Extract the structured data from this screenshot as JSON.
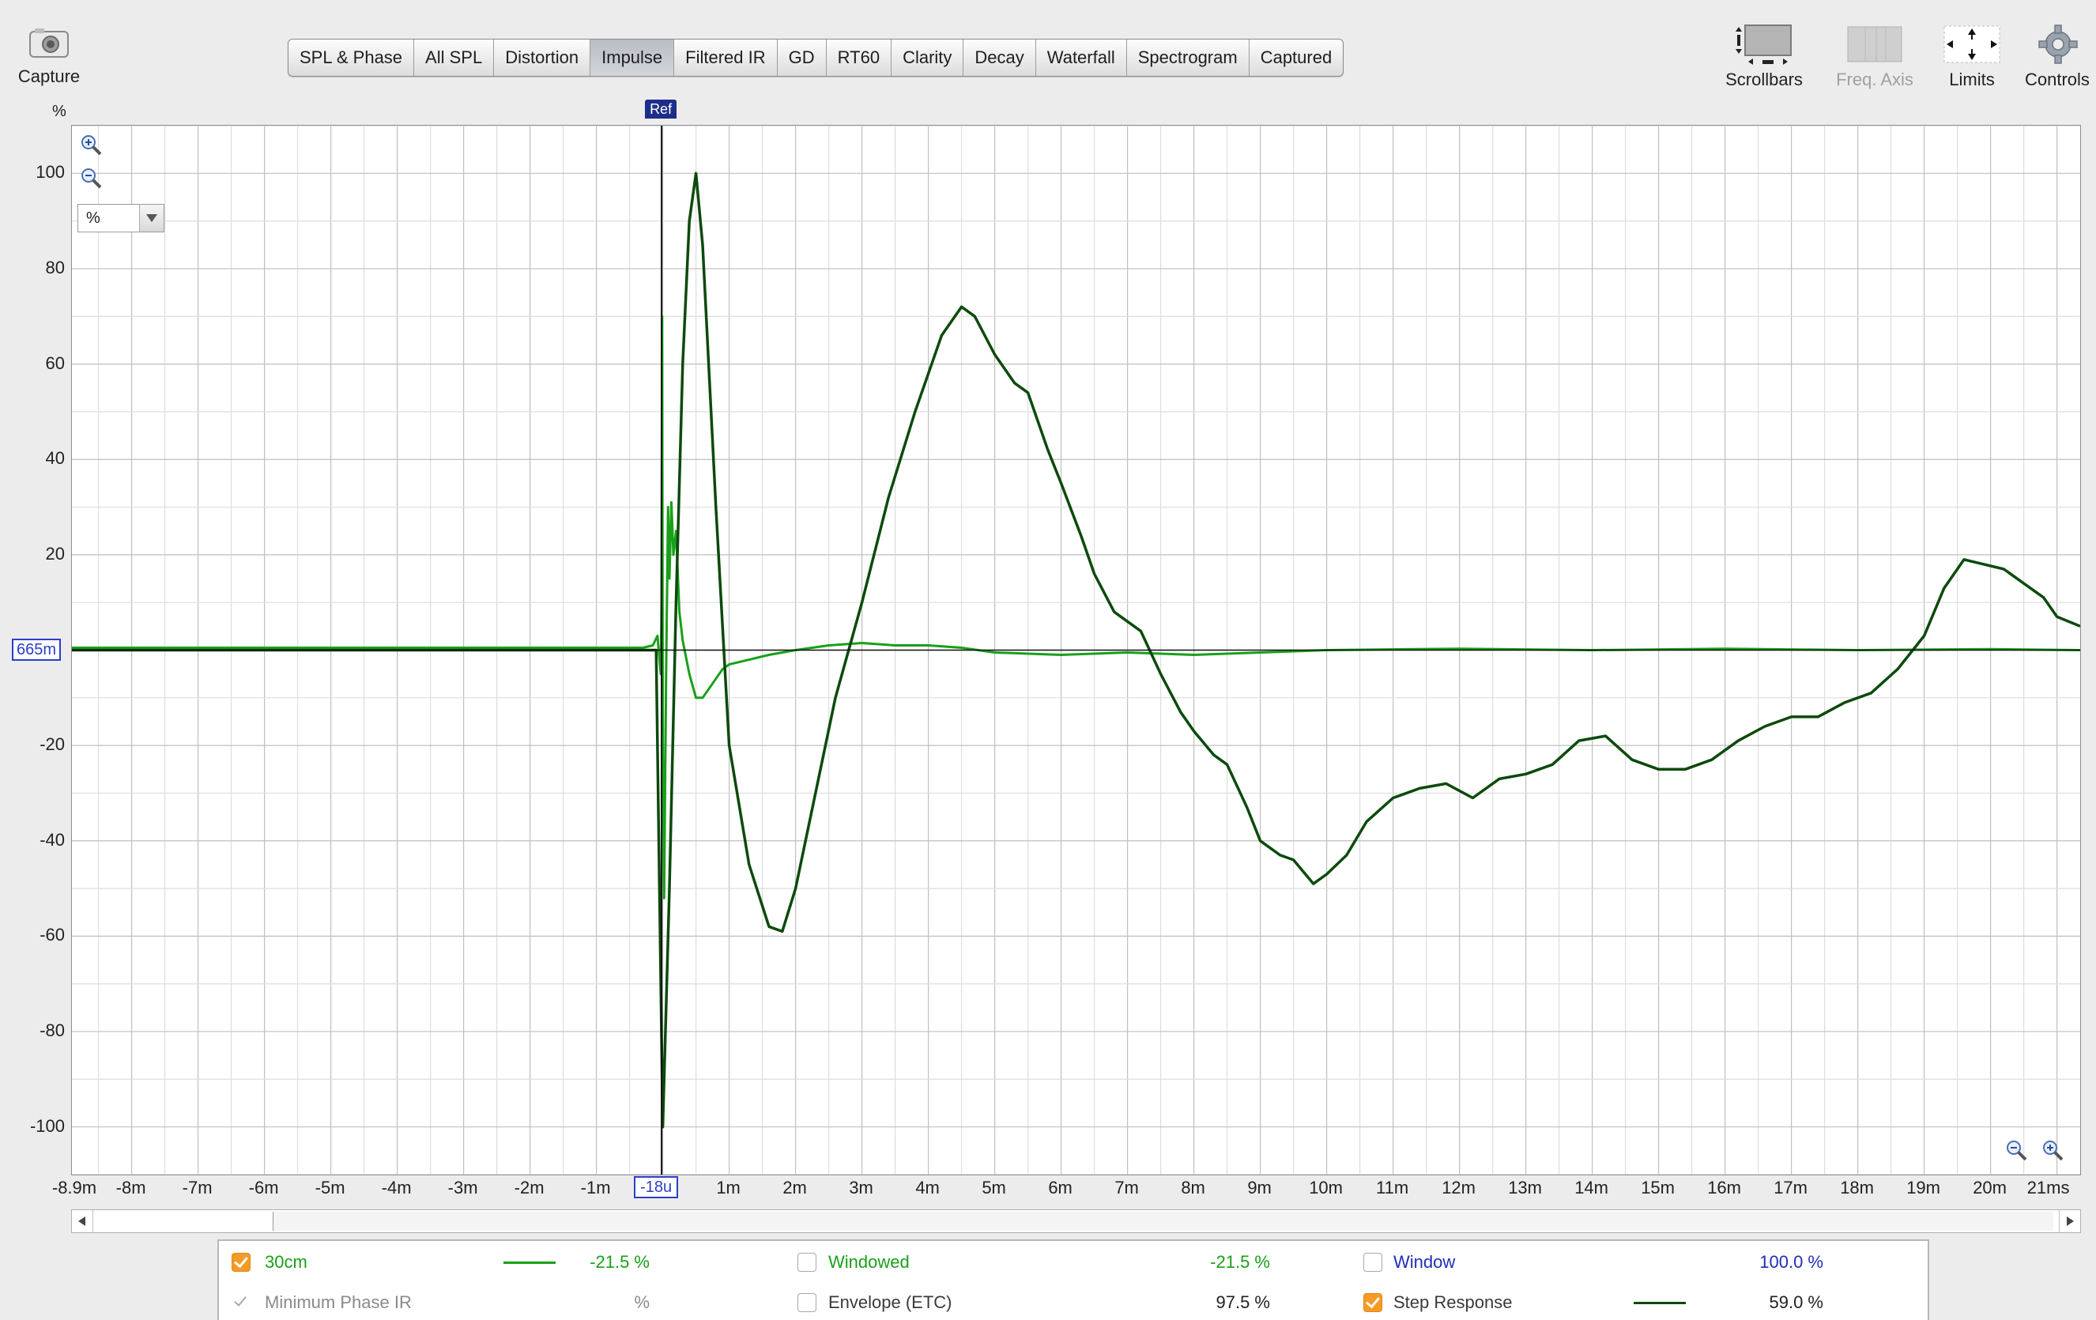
{
  "toolbar": {
    "capture_label": "Capture",
    "scrollbars_label": "Scrollbars",
    "freq_axis_label": "Freq. Axis",
    "limits_label": "Limits",
    "controls_label": "Controls"
  },
  "tabs": [
    {
      "label": "SPL & Phase",
      "active": false
    },
    {
      "label": "All SPL",
      "active": false
    },
    {
      "label": "Distortion",
      "active": false
    },
    {
      "label": "Impulse",
      "active": true
    },
    {
      "label": "Filtered IR",
      "active": false
    },
    {
      "label": "GD",
      "active": false
    },
    {
      "label": "RT60",
      "active": false
    },
    {
      "label": "Clarity",
      "active": false
    },
    {
      "label": "Decay",
      "active": false
    },
    {
      "label": "Waterfall",
      "active": false
    },
    {
      "label": "Spectrogram",
      "active": false
    },
    {
      "label": "Captured",
      "active": false
    }
  ],
  "plot": {
    "y_unit": "%",
    "unit_select_value": "%",
    "ref_label": "Ref",
    "cursor_y_readout": "665m",
    "cursor_x_readout": "-18u"
  },
  "chart_data": {
    "type": "line",
    "x_unit": "ms",
    "xlim": [
      -8.9,
      21.35
    ],
    "ylim": [
      -110,
      110
    ],
    "grid": true,
    "x_tick_labels": [
      "-8.9m",
      "-8m",
      "-7m",
      "-6m",
      "-5m",
      "-4m",
      "-3m",
      "-2m",
      "-1m",
      "-18u",
      "1m",
      "2m",
      "3m",
      "4m",
      "5m",
      "6m",
      "7m",
      "8m",
      "9m",
      "10m",
      "11m",
      "12m",
      "13m",
      "14m",
      "15m",
      "16m",
      "17m",
      "18m",
      "19m",
      "20m",
      "21ms"
    ],
    "x_tick_values": [
      -8.9,
      -8,
      -7,
      -6,
      -5,
      -4,
      -3,
      -2,
      -1,
      -0.018,
      1,
      2,
      3,
      4,
      5,
      6,
      7,
      8,
      9,
      10,
      11,
      12,
      13,
      14,
      15,
      16,
      17,
      18,
      19,
      20,
      21
    ],
    "y_tick_labels": [
      "100",
      "80",
      "60",
      "40",
      "20",
      "-20",
      "-40",
      "-60",
      "-80",
      "-100"
    ],
    "y_tick_values": [
      100,
      80,
      60,
      40,
      20,
      -20,
      -40,
      -60,
      -80,
      -100
    ],
    "series": [
      {
        "name": "30cm",
        "color": "#19a019",
        "x": [
          -8.9,
          -1.0,
          -0.3,
          -0.15,
          -0.08,
          -0.05,
          -0.03,
          -0.02,
          -0.01,
          0.0,
          0.02,
          0.05,
          0.08,
          0.1,
          0.13,
          0.16,
          0.2,
          0.25,
          0.3,
          0.4,
          0.5,
          0.6,
          0.7,
          0.8,
          0.9,
          1.0,
          1.3,
          1.6,
          2.0,
          2.5,
          3.0,
          3.5,
          4.0,
          4.5,
          5.0,
          6.0,
          7.0,
          8.0,
          9.0,
          10.0,
          12.0,
          14.0,
          16.0,
          18.0,
          20.0,
          21.35
        ],
        "y": [
          0.5,
          0.5,
          0.5,
          1.0,
          3.0,
          -2.0,
          -5.0,
          10.0,
          70.0,
          -20.0,
          -52.0,
          -5.0,
          30.0,
          15.0,
          31.0,
          20.0,
          25.0,
          8.0,
          2.0,
          -5.0,
          -10.0,
          -10.0,
          -8.0,
          -6.0,
          -4.0,
          -3.0,
          -2.0,
          -1.0,
          0.0,
          1.0,
          1.5,
          1.0,
          1.0,
          0.5,
          -0.5,
          -1.0,
          -0.5,
          -1.0,
          -0.5,
          0.0,
          0.3,
          0.0,
          0.3,
          0.0,
          0.2,
          0.0
        ]
      },
      {
        "name": "Step Response",
        "color": "#0c4a0c",
        "x": [
          -8.9,
          -1.0,
          -0.1,
          0.0,
          0.1,
          0.2,
          0.3,
          0.4,
          0.5,
          0.6,
          0.8,
          1.0,
          1.3,
          1.6,
          1.8,
          2.0,
          2.3,
          2.6,
          3.0,
          3.4,
          3.8,
          4.0,
          4.2,
          4.5,
          4.7,
          5.0,
          5.3,
          5.5,
          5.8,
          6.0,
          6.3,
          6.5,
          6.8,
          7.0,
          7.2,
          7.5,
          7.8,
          8.0,
          8.3,
          8.5,
          8.8,
          9.0,
          9.3,
          9.5,
          9.8,
          10.0,
          10.3,
          10.6,
          11.0,
          11.4,
          11.8,
          12.2,
          12.6,
          13.0,
          13.4,
          13.8,
          14.2,
          14.6,
          15.0,
          15.4,
          15.8,
          16.2,
          16.6,
          17.0,
          17.4,
          17.8,
          18.2,
          18.6,
          19.0,
          19.3,
          19.6,
          19.9,
          20.2,
          20.5,
          20.8,
          21.0,
          21.35
        ],
        "y": [
          0.0,
          0.0,
          0.0,
          -100.0,
          -50.0,
          10.0,
          60.0,
          90.0,
          100.0,
          85.0,
          30.0,
          -20.0,
          -45.0,
          -58.0,
          -59.0,
          -50.0,
          -30.0,
          -10.0,
          10.0,
          32.0,
          50.0,
          58.0,
          66.0,
          72.0,
          70.0,
          62.0,
          56.0,
          54.0,
          42.0,
          35.0,
          24.0,
          16.0,
          8.0,
          6.0,
          4.0,
          -5.0,
          -13.0,
          -17.0,
          -22.0,
          -24.0,
          -33.0,
          -40.0,
          -43.0,
          -44.0,
          -49.0,
          -47.0,
          -43.0,
          -36.0,
          -31.0,
          -29.0,
          -28.0,
          -31.0,
          -27.0,
          -26.0,
          -24.0,
          -19.0,
          -18.0,
          -23.0,
          -25.0,
          -25.0,
          -23.0,
          -19.0,
          -16.0,
          -14.0,
          -14.0,
          -11.0,
          -9.0,
          -4.0,
          3.0,
          13.0,
          19.0,
          18.0,
          17.0,
          14.0,
          11.0,
          7.0,
          5.0
        ]
      }
    ],
    "reference_line_y": 0,
    "ref_marker_x": -0.018
  },
  "legend": {
    "items": [
      {
        "label": "30cm",
        "value": "-21.5 %",
        "checked": true,
        "label_color": "#19a019",
        "swatch": "#19a019"
      },
      {
        "label": "Windowed",
        "value": "-21.5 %",
        "checked": false,
        "label_color": "#19a019"
      },
      {
        "label": "Window",
        "value": "100.0 %",
        "checked": false,
        "label_color": "#1f2fb5"
      },
      {
        "label": "Minimum Phase IR",
        "value": "%",
        "checked": false,
        "label_color": "#8a8a8a"
      },
      {
        "label": "Envelope (ETC)",
        "value": "97.5 %",
        "checked": false,
        "label_color": "#3a3a3a"
      },
      {
        "label": "Step Response",
        "value": "59.0 %",
        "checked": true,
        "label_color": "#3a3a3a",
        "swatch": "#0c4a0c"
      }
    ]
  }
}
